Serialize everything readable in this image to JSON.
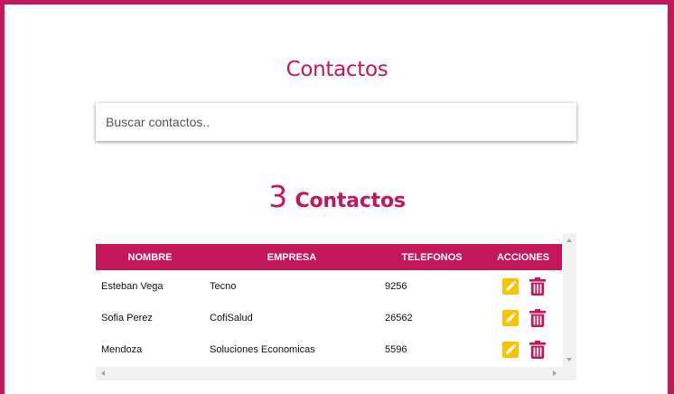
{
  "page": {
    "title": "Contactos",
    "search": {
      "placeholder": "Buscar contactos..",
      "value": ""
    },
    "count": {
      "number": "3",
      "label": "Contactos"
    }
  },
  "table": {
    "headers": [
      "NOMBRE",
      "EMPRESA",
      "TELEFONOS",
      "ACCIONES"
    ],
    "rows": [
      {
        "nombre": "Esteban Vega",
        "empresa": "Tecno",
        "telefono": "9256"
      },
      {
        "nombre": "Sofia Perez",
        "empresa": "CofiSalud",
        "telefono": "26562"
      },
      {
        "nombre": "Mendoza",
        "empresa": "Soluciones Economicas",
        "telefono": "5596"
      }
    ],
    "actions": {
      "edit_icon": "pencil-icon",
      "delete_icon": "trash-icon"
    }
  },
  "colors": {
    "brand": "#c4175b",
    "edit_button": "#f7c400",
    "delete_icon": "#c4175b"
  }
}
